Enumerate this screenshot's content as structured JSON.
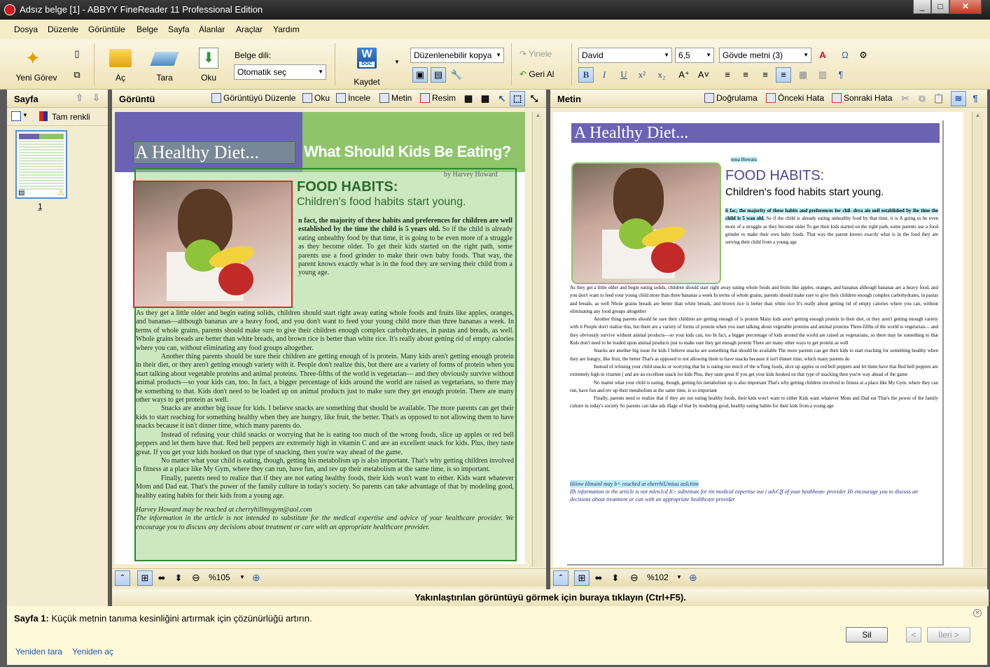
{
  "window": {
    "title": "Adsız belge [1] - ABBYY FineReader 11 Professional Edition",
    "buttons": [
      "_",
      "□",
      "✕"
    ]
  },
  "menu": [
    "Dosya",
    "Düzenle",
    "Görüntüle",
    "Belge",
    "Sayfa",
    "Alanlar",
    "Araçlar",
    "Yardım"
  ],
  "ribbon": {
    "new_task": "Yeni Görev",
    "open": "Aç",
    "scan": "Tara",
    "read": "Oku",
    "doc_lang_label": "Belge dili:",
    "doc_lang_value": "Otomatik seç",
    "save": "Kaydet",
    "save_icon_text": "W",
    "save_icon_sub": "DOC",
    "format_value": "Düzenlenebilir kopya",
    "redo": "Yinele",
    "undo": "Geri Al",
    "font": "David",
    "font_size": "6,5",
    "style": "Gövde metni (3)",
    "bold": "B",
    "italic": "I",
    "underline": "U",
    "superscript": "x²",
    "subscript": "x₂",
    "grow": "A⁺",
    "shrink": "A˅",
    "omega": "Ω",
    "pilcrow": "¶"
  },
  "left_panel": {
    "title": "Sayfa",
    "color_mode": "Tam renkli",
    "page_number": "1"
  },
  "image_panel": {
    "title": "Görüntü",
    "tools": [
      "Görüntüyü Düzenle",
      "Oku",
      "İncele",
      "Metin",
      "Resim"
    ],
    "zoom": "%105",
    "article": {
      "header_left": "A Healthy Diet...",
      "header_right": "What Should Kids Be Eating?",
      "byline": "by Harvey Howard",
      "heading": "FOOD HABITS:",
      "subheading": "Children's food habits start young.",
      "lead": "n fact, the majority of these habits and preferences for children are well established by the time the child is 5 years old.",
      "p1": "So if the child is already eating unhealthy food by that time, it is going to be even more of a struggle as they become older. To get their kids started on the right path, some parents use a food grinder to make their own baby foods. That way, the parent knows exactly what is in the food they are serving their child from a young age.",
      "p2": "As they get a little older and begin eating solids, children should start right away eating whole foods and fruits like apples, oranges, and bananas—although bananas are a heavy food, and you don't want to feed your young child more than three bananas a week. In terms of whole grains, parents should make sure to give their children enough complex carbohydrates, in pastas and breads, as well. Whole grains breads are better than white breads, and brown rice is better than white rice. It's really about getting rid of empty calories where you can, without eliminating any food groups altogether.",
      "p3": "Another thing parents should be sure their children are getting enough of is protein. Many kids aren't getting enough protein in their diet, or they aren't getting enough variety with it. People don't realize this, but there are a variety of forms of protein when you start talking about vegetable proteins and animal proteins. Three-fifths of the world is vegetarian— and they obviously survive without animal products—so your kids can, too. In fact, a bigger percentage of kids around the world are raised as vegetarians, so there may be something to that. Kids don't need to be loaded up on animal products just to make sure they get enough protein. There are many other ways to get protein as well.",
      "p4": "Snacks are another big issue for kids. I believe snacks are something that should be available. The more parents can get their kids to start reaching for something healthy when they are hungry, like fruit, the better. That's as opposed to not allowing them to have snacks because it isn't dinner time, which many parents do.",
      "p5": "Instead of refusing your child snacks or worrying that he is eating too much of the wrong foods, slice up apples or red bell peppers and let them have that. Red bell peppers are extremely high in vitamin C and are an excellent snack for kids. Plus, they taste great. If you get your kids hooked on that type of snacking, then you're way ahead of the game.",
      "p6": "No matter what your child is eating, though, getting his metabolism up is also important. That's why getting children involved in fitness at a place like My Gym, where they can run, have fun, and rev up their metabolism at the same time, is so important.",
      "p7": "Finally, parents need to realize that if they are not eating healthy foods, their kids won't want to either. Kids want whatever Mom and Dad eat. That's the power of the family culture in today's society. So parents can take advantage of that by modeling good, healthy eating habits for their kids from a young age.",
      "footer1": "Harvey Howard may be reached at cherryhillmygym@aol.com",
      "footer2": "The information in the article is not intended to substitute for the medical expertise and advice of your healthcare provider. We encourage you to discuss any decisions about treatment or care with an appropriate healthcare provider."
    }
  },
  "text_panel": {
    "title": "Metin",
    "tools": [
      "Doğrulama",
      "Önceki Hata",
      "Sonraki Hata"
    ],
    "zoom": "%102",
    "doc": {
      "header": "A Healthy Diet...",
      "byline": "uosa Howara",
      "heading": "FOOD HABITS:",
      "subheading": "Children's food habits start young.",
      "lead": "ii fac; the majority of these habits and preferences for chil- drra aie ueil established by ihe time the child is 5 wan old.",
      "p1": "So if the child is already eating unhealthy food by that time, it is A going to be even more of a struggle as they become older To get their kids started on the right path, some parents use a food grinder to make their own baby foods. That way the parent knows exactly what is in the food they are serving their child from a young age",
      "p2": "As they get a little older and begin eating solids, children should start right away eating whole foods and fruits like apples, oranges, and bananas although bananas are a heavy food, and you don't want to feed your young child more than three bananas a week In terms of whole grains, parents should make sure to give their children enough complex carbohydrates, in pastas and breads, as well Nhole grains breads are better than white breads, and brown rice is better than white rice It's really about getting rid of empty calories where you can, without eliminating any food groups altogether",
      "p3": "Another thing parents should be sure their children are getting enough of is protein Many kids aren't getting enough protein in their diet, or they aren't getting enough variety with it People don't realize this, but there are a variety of forms of protein when you start talking about vegetable proteins and animal proteins Three-fifths of the world is vegetarian— and they obviously survive without animal products—so your kids can, too In fact, a bigger percentage of kids around the world are raised as vegetarians, so there may be something to that Kids don't need to be loaded upon animal products just to make sure they get enough protein There are many other ways to get protein as well",
      "p4": "Snacks are another big issue for kids I believe snacks are something that should be available The more parents can get their kids to start reaching for something healthy when they are hungry, like fruit, the better That's as opposed to not allowing them to have snacks because it isn't dinner time, which many parents do",
      "p5": "Instead of refusing your child snacks or worrying that he is eating too much of the wTong foods, slice up apples or red bell peppers and let them have that Red bell peppers are extremely high in vitamin ( and are an excellent snack for kids Plus, they taste great If you get your kids hooked on that type of snacking then you're way ahead of the game",
      "p6": "No matter what your child is eating, though, getting his metabolism up is also important That's why getting children involved in fitness at a place like My Gym. where they can run, have fun and rev up their metabolism at the same time, is so important",
      "p7": "Finally, parents need to realize that if they are not eating healthy foods, their kids won't want to either Kids want whatever Mom and Dad eat That's the power of the family culture in today's society So parents can take ads illage of that by modeling good, healthy eating habits for their kids from a young age",
      "footer1": "Hiinw Hinuinl may b< reached at eherrhiUmiuu aolcitim",
      "footer2": "Ilh information in the article is not mlenJcd Ii> substitute for tin medical expertise nui i advCff of your heahhean- provider Hi encourage you to discuss an decisions about treatment or can with an appropriate healthcare provider"
    }
  },
  "status": {
    "zoom_hint": "Yakınlaştırılan görüntüyü görmek için buraya tıklayın (Ctrl+F5)."
  },
  "message": {
    "page_label": "Sayfa 1:",
    "text": "Küçük metnin tanıma kesinliğini artırmak için çözünürlüğü artırın.",
    "delete": "Sil",
    "prev": "<",
    "next": "İleri >",
    "rescan": "Yeniden tara",
    "reopen": "Yeniden aç"
  },
  "colors": {
    "ribbon_bg": "#f3e9c6",
    "article_purple": "#6b62b3",
    "article_green": "#8fc46b",
    "selection_green": "#2a8a2a",
    "picture_red": "#d62a2a",
    "cyan_highlight": "#bfeef5"
  }
}
